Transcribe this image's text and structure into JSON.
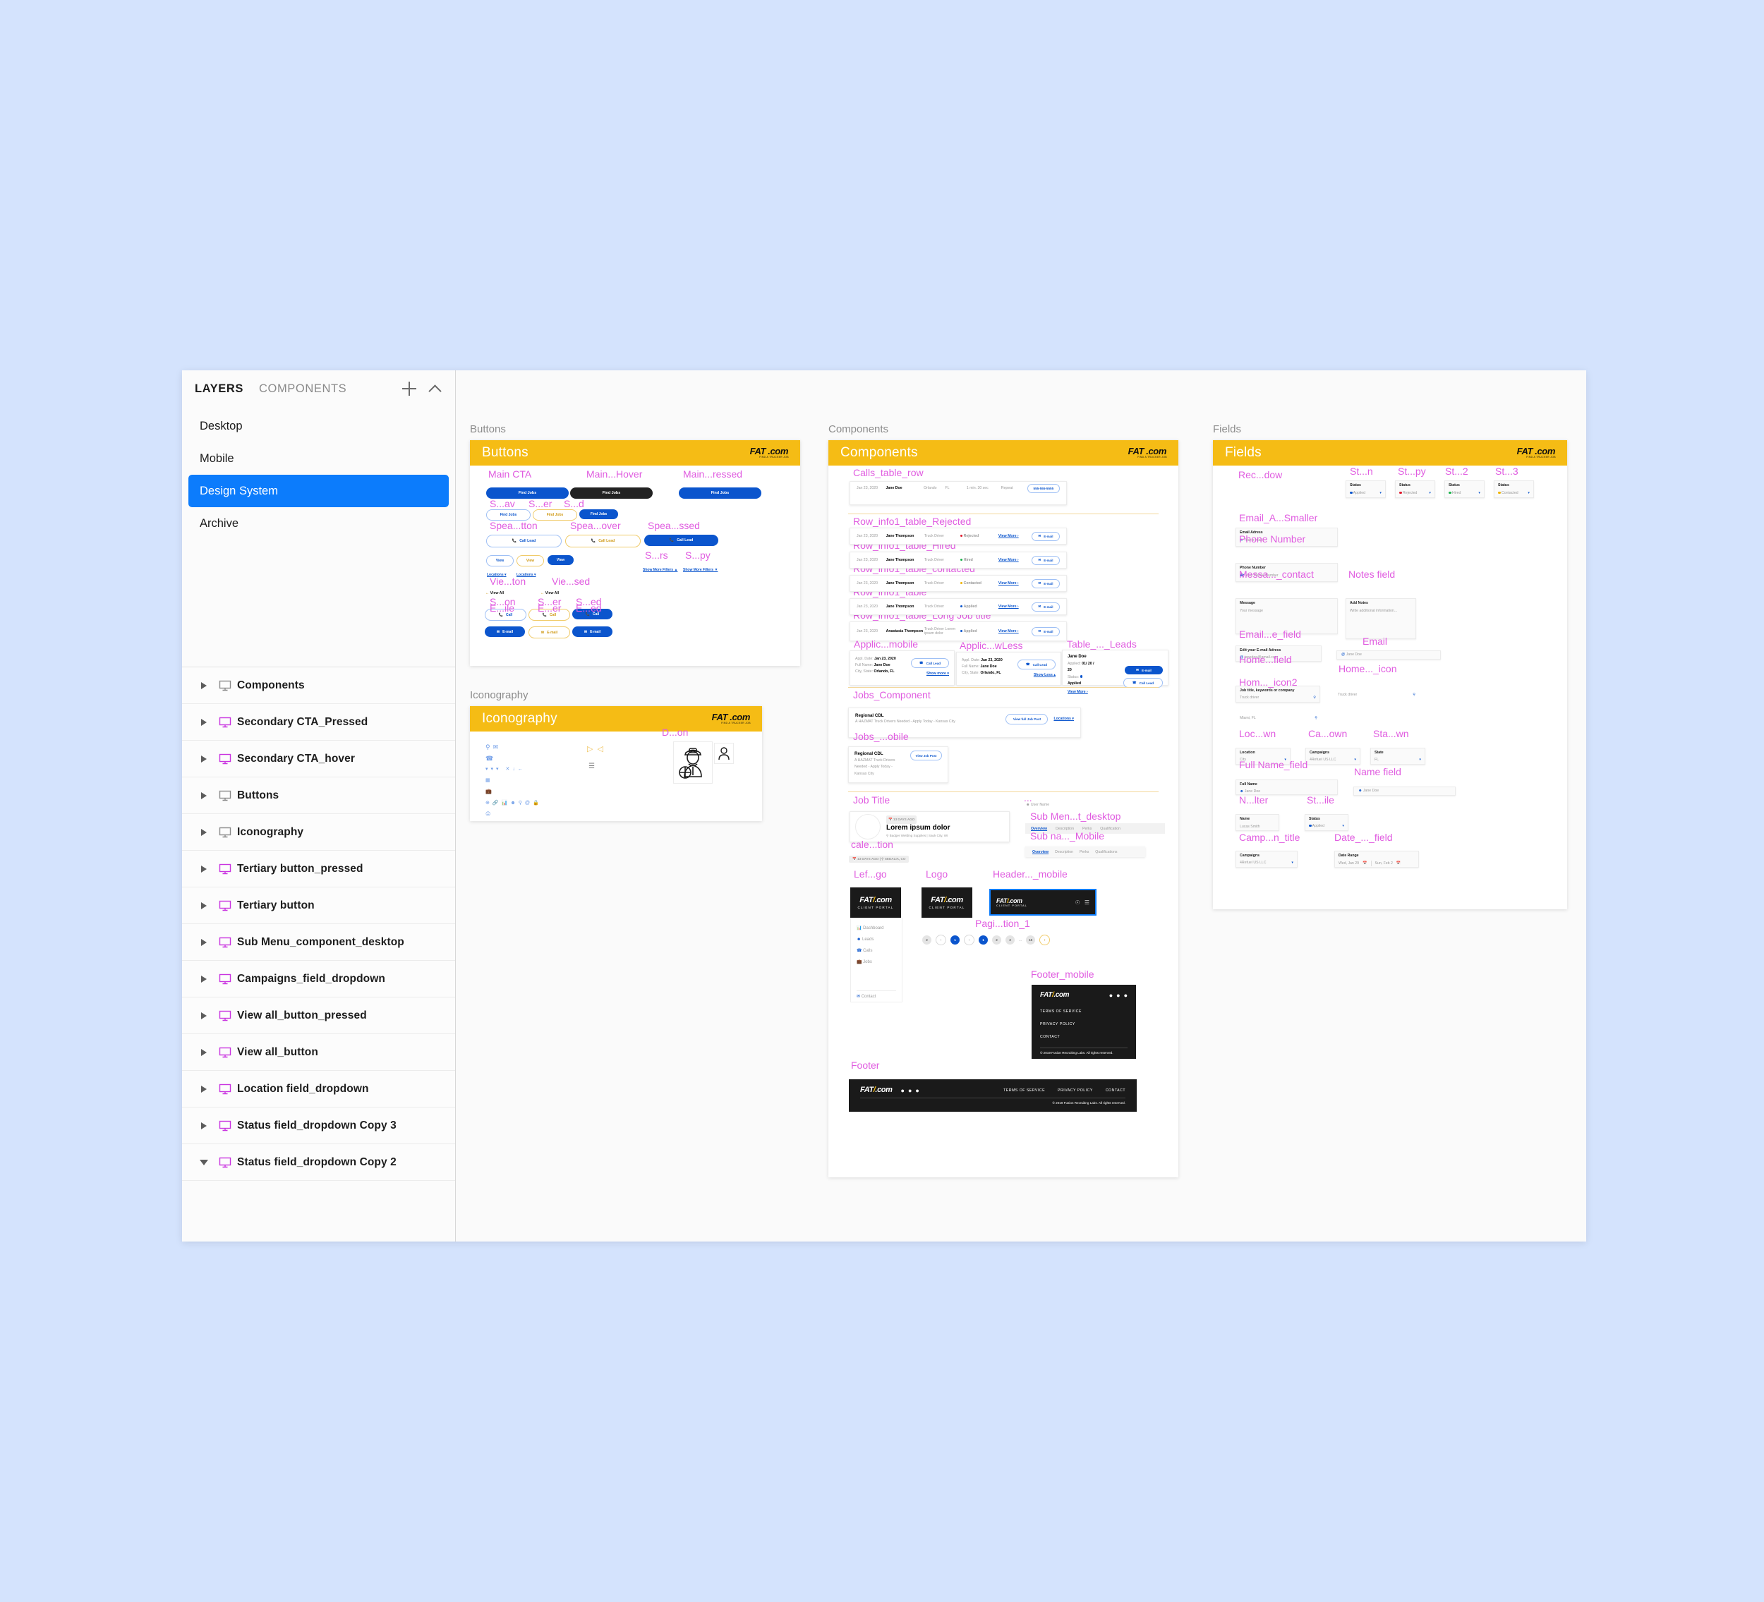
{
  "panel": {
    "tabs": [
      {
        "label": "LAYERS",
        "active": true
      },
      {
        "label": "COMPONENTS",
        "active": false
      }
    ],
    "actions": [
      {
        "name": "add-page-button",
        "icon": "plus-icon"
      },
      {
        "name": "collapse-button",
        "icon": "chevron-up-icon"
      }
    ],
    "pages": [
      {
        "label": "Desktop",
        "selected": false
      },
      {
        "label": "Mobile",
        "selected": false
      },
      {
        "label": "Design System",
        "selected": true
      },
      {
        "label": "Archive",
        "selected": false
      }
    ],
    "layers": [
      {
        "label": "Components",
        "type": "frame",
        "expanded": false
      },
      {
        "label": "Secondary CTA_Pressed",
        "type": "component",
        "expanded": false
      },
      {
        "label": "Secondary CTA_hover",
        "type": "component",
        "expanded": false
      },
      {
        "label": "Buttons",
        "type": "frame",
        "expanded": false
      },
      {
        "label": "Iconography",
        "type": "frame",
        "expanded": false
      },
      {
        "label": "Tertiary button_pressed",
        "type": "component",
        "expanded": false
      },
      {
        "label": "Tertiary button",
        "type": "component",
        "expanded": false
      },
      {
        "label": "Sub Menu_component_desktop",
        "type": "component",
        "expanded": false
      },
      {
        "label": "Campaigns_field_dropdown",
        "type": "component",
        "expanded": false
      },
      {
        "label": "View all_button_pressed",
        "type": "component",
        "expanded": false
      },
      {
        "label": "View all_button",
        "type": "component",
        "expanded": false
      },
      {
        "label": "Location field_dropdown",
        "type": "component",
        "expanded": false
      },
      {
        "label": "Status field_dropdown Copy 3",
        "type": "component",
        "expanded": false
      },
      {
        "label": "Status field_dropdown Copy 2",
        "type": "component",
        "expanded": true
      }
    ]
  },
  "colors": {
    "selection_blue": "#0c7cfc",
    "frame_header_yellow": "#f5bc15",
    "component_pink": "#e05ce0",
    "component_purple_icon": "#c934e0",
    "brand_blue": "#0b55cd",
    "page_background": "#d4e3fd"
  },
  "logo": {
    "line1_a": "FAT",
    "line1_b": ".com",
    "line2": "FIND A TRUCKER JOB",
    "portal_sub": "CLIENT PORTAL"
  },
  "frames": {
    "buttons": {
      "canvas_label": "Buttons",
      "header_title": "Buttons",
      "labels": [
        "Main CTA",
        "Main...Hover",
        "Main...ressed",
        "S...av",
        "S...er",
        "S...d",
        "Spea...tton",
        "Spea...over",
        "Spea...ssed",
        "S...rs",
        "S...py",
        "Vie...ton",
        "Vie...sed",
        "S...on",
        "S...er",
        "S...ed",
        "E...ile",
        "E...er",
        "E...ed"
      ],
      "find_jobs": "Find Jobs",
      "call_lead": "Call Lead",
      "view": "View",
      "locations": "Locations",
      "view_all": "View All",
      "show_more_filters": "Show More Filters",
      "email": "E-mail",
      "call": "Call"
    },
    "iconography": {
      "canvas_label": "Iconography",
      "header_title": "Iconography",
      "driver_label": "D...on",
      "icons": [
        "location-pin-icon",
        "envelope-icon",
        "phone-icon",
        "chevron-down-icon",
        "chevron-down-icon",
        "chevron-down-icon",
        "close-icon",
        "arrow-down-icon",
        "arrow-left-icon",
        "id-card-icon",
        "briefcase-icon",
        "plus-circle-icon",
        "link-icon",
        "bar-chart-icon",
        "user-icon",
        "search-icon",
        "at-icon",
        "lock-icon",
        "sad-face-icon",
        "chevron-right-circle-icon",
        "chevron-left-circle-icon",
        "hamburger-icon",
        "truck-driver-icon",
        "avatar-icon"
      ]
    },
    "components": {
      "canvas_label": "Components",
      "header_title": "Components",
      "labels": [
        "Calls_table_row",
        "Row_info1_table_Rejected",
        "Row_info1_table_Hired",
        "Row_info1_table_contacted",
        "Row_info1_table",
        "Row_info1_table_Long Job title",
        "Applic...mobile",
        "Applic...wLess",
        "Table_..._Leads",
        "Jobs_Component",
        "Jobs_...obile",
        "Job Title",
        "cale...tion",
        "...",
        "Sub Men...t_desktop",
        "Sub na..._Mobile",
        "Lef...go",
        "Logo",
        "Header..._mobile",
        "Pagi...tion_1",
        "Footer_mobile",
        "Footer"
      ],
      "calls_row": {
        "date": "Jan 23, 2020",
        "name": "Jane Doe",
        "city": "Orlando",
        "state": "FL",
        "duration": "1 min. 30 sec",
        "type": "Repeat",
        "phone": "555-555-5555"
      },
      "info_rows": [
        {
          "date": "Jan 23, 2020",
          "name": "Jane Thompson",
          "job": "Truck Driver",
          "status": "Rejected",
          "status_color": "#e0192c",
          "cta": "View More",
          "email": "E-mail"
        },
        {
          "date": "Jan 23, 2020",
          "name": "Jane Thompson",
          "job": "Truck Driver",
          "status": "Hired",
          "status_color": "#19b34a",
          "cta": "View More",
          "email": "E-mail"
        },
        {
          "date": "Jan 23, 2020",
          "name": "Jane Thompson",
          "job": "Truck Driver",
          "status": "Contacted",
          "status_color": "#f0b400",
          "cta": "View More",
          "email": "E-mail"
        },
        {
          "date": "Jan 23, 2020",
          "name": "Jane Thompson",
          "job": "Truck Driver",
          "status": "Applied",
          "status_color": "#0b55cd",
          "cta": "View More",
          "email": "E-mail"
        },
        {
          "date": "Jan 23, 2020",
          "name": "Anastasia Thompson",
          "job": "Truck Driver Lorem ipsum dolor",
          "status": "Applied",
          "status_color": "#0b55cd",
          "cta": "View More",
          "email": "E-mail"
        }
      ],
      "applicant_mobile": {
        "l1": "Appl. Date:",
        "v1": "Jan 23, 2020",
        "l2": "Full Name:",
        "v2": "Jane Doe",
        "l3": "City, State:",
        "v3": "Orlando, FL",
        "cta": "Call Lead",
        "toggle": "Show more"
      },
      "applicant_showless": {
        "l1": "Appl. Date:",
        "v1": "Jan 23, 2020",
        "l2": "Full Name:",
        "v2": "Jane Doe",
        "l3": "City, State:",
        "v3": "Orlando, FL",
        "cta": "Call Lead",
        "toggle": "Show Less"
      },
      "table_leads": {
        "name": "Jane Doe",
        "applied_label": "Applied:",
        "applied_value": "01/ 20 / 20",
        "status_label": "Status:",
        "status_value": "Applied",
        "view_more": "View More",
        "email": "E-mail",
        "call": "Call Lead"
      },
      "job_component": {
        "title": "Regional CDL",
        "desc": "A HAZMAT Truck Drivers Needed - Apply Today - Kansas City",
        "cta": "View full Job Post",
        "dropdown": "Locations"
      },
      "job_mobile": {
        "title": "Regional CDL",
        "desc": "A HAZMAT Truck Drivers Needed - Apply Today - Kansas City",
        "cta": "View Job Post"
      },
      "job_title_card": {
        "tag": "13 DAYS AGO",
        "title": "Lorem ipsum dolor",
        "sub": "Badger Welding Supplies | Sauk City, WI"
      },
      "calendar_tag": {
        "days": "13 DAYS AGO",
        "sep": "|",
        "place": "SEDALIA, CO"
      },
      "user_name": "User Name",
      "submenu_desktop": [
        "Overview",
        "Description",
        "Perks",
        "Qualification"
      ],
      "submenu_mobile": [
        "Overview",
        "Description",
        "Perks",
        "Qualifications"
      ],
      "left_nav": [
        "Dashboard",
        "Leads",
        "Calls",
        "Jobs"
      ],
      "left_nav_footer": "Contact",
      "pagination": {
        "left_num": "2",
        "items": [
          "1",
          "1",
          "2",
          "3",
          "...",
          "15"
        ]
      },
      "footer": {
        "links": [
          "TERMS OF SERVICE",
          "PRIVACY POLICY",
          "CONTACT"
        ],
        "copyright": "© 2019 Fusion Recruiting Labs. All rights reserved.",
        "social": [
          "twitter-icon",
          "facebook-icon",
          "linkedin-icon"
        ]
      }
    },
    "fields": {
      "canvas_label": "Fields",
      "header_title": "Fields",
      "labels": [
        "Rec...dow",
        "St...n",
        "St...py",
        "St...2",
        "St...3",
        "Email_A...Smaller",
        "Phone Number",
        "Messa..._contact",
        "Notes field",
        "Email...e_field",
        "Email",
        "Home...field",
        "Home..._icon",
        "Hom..._icon2",
        "Loc...wn",
        "Ca...own",
        "Sta...wn",
        "Full Name_field",
        "Name field",
        "N...lter",
        "St...ile",
        "Camp...n_title",
        "Date_..._field"
      ],
      "status_dropdowns": [
        {
          "label": "Status",
          "value": "Applied",
          "color": "#0b55cd"
        },
        {
          "label": "Status",
          "value": "Rejected",
          "color": "#e0192c"
        },
        {
          "label": "Status",
          "value": "Hired",
          "color": "#19b34a"
        },
        {
          "label": "Status",
          "value": "Contacted",
          "color": "#f0b400"
        }
      ],
      "email_small": {
        "label": "Email Adress",
        "placeholder": "Your e-mail"
      },
      "phone": {
        "label": "Phone Number",
        "placeholder": "Your Phone Number"
      },
      "message": {
        "label": "Message",
        "placeholder": "Your message"
      },
      "notes": {
        "label": "Add Notes",
        "placeholder": "Write additional information..."
      },
      "email_edit": {
        "label": "Edit your E-mail Adress",
        "value": "janedoe@gmail.com"
      },
      "email_plain": {
        "value": "Jane Doe"
      },
      "home_search": {
        "label": "Job title, keywords or company",
        "value": "Truck driver"
      },
      "home_icon": {
        "value": "Truck driver"
      },
      "home_icon2": {
        "value": "Miami, FL"
      },
      "location_dd": {
        "label": "Location",
        "value": "City"
      },
      "campaigns_dd": {
        "label": "Campaigns",
        "value": "4Refuel US LLC"
      },
      "state_dd": {
        "label": "State",
        "value": "FL"
      },
      "full_name": {
        "label": "Full Name",
        "value": "Jane Doe"
      },
      "name_plain": {
        "value": "Jane Doe"
      },
      "name_filter": {
        "label": "Name",
        "value": "Lucas Smith"
      },
      "status_profile": {
        "label": "Status",
        "value": "Applied",
        "color": "#0b55cd"
      },
      "campaign_title": {
        "label": "Campaigns",
        "value": "4Refuel US LLC"
      },
      "date_range": {
        "label": "Date Range",
        "from": "Wed, Jan 29",
        "to": "Sun, Feb 2"
      }
    }
  }
}
